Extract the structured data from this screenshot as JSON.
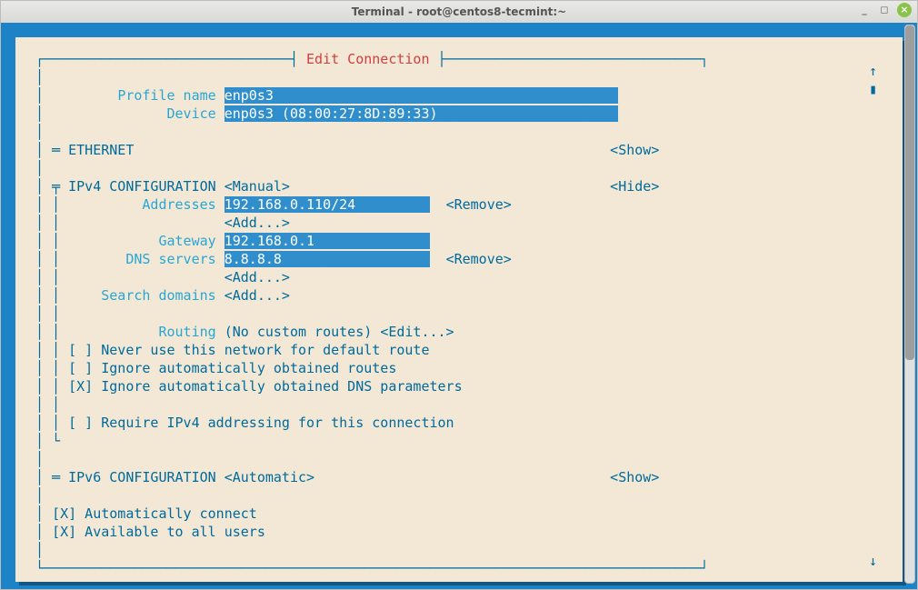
{
  "window": {
    "title": "Terminal - root@centos8-tecmint:~"
  },
  "dialog": {
    "title": "Edit Connection"
  },
  "profile": {
    "name_label": "Profile name",
    "name_value": "enp0s3",
    "device_label": "Device",
    "device_value": "enp0s3 (08:00:27:8D:89:33)"
  },
  "sections": {
    "ethernet_label": "ETHERNET",
    "ethernet_toggle": "<Show>",
    "ipv4_label": "IPv4 CONFIGURATION",
    "ipv4_mode": "<Manual>",
    "ipv4_toggle": "<Hide>",
    "ipv6_label": "IPv6 CONFIGURATION",
    "ipv6_mode": "<Automatic>",
    "ipv6_toggle": "<Show>"
  },
  "ipv4": {
    "addresses_label": "Addresses",
    "address0": "192.168.0.110/24",
    "address0_remove": "<Remove>",
    "address_add": "<Add...>",
    "gateway_label": "Gateway",
    "gateway_value": "192.168.0.1",
    "dns_label": "DNS servers",
    "dns0": "8.8.8.8",
    "dns0_remove": "<Remove>",
    "dns_add": "<Add...>",
    "search_label": "Search domains",
    "search_add": "<Add...>",
    "routing_label": "Routing",
    "routing_status": "(No custom routes)",
    "routing_edit": "<Edit...>",
    "chk_never_default": "[ ] Never use this network for default route",
    "chk_ignore_routes": "[ ] Ignore automatically obtained routes",
    "chk_ignore_dns": "[X] Ignore automatically obtained DNS parameters",
    "chk_require_v4": "[ ] Require IPv4 addressing for this connection"
  },
  "general": {
    "autoconnect": "[X] Automatically connect",
    "all_users": "[X] Available to all users"
  },
  "scroll": {
    "up": "↑",
    "block": "▮",
    "down": "↓"
  }
}
